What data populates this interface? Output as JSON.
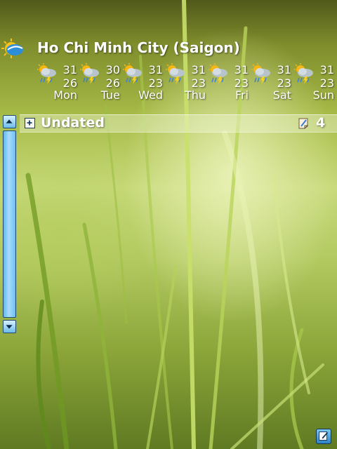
{
  "weather": {
    "city": "Ho Chi Minh City (Saigon)",
    "forecast": [
      {
        "day": "Mon",
        "high": "31",
        "low": "26",
        "icon": "thunderstorm-icon"
      },
      {
        "day": "Tue",
        "high": "30",
        "low": "26",
        "icon": "thunderstorm-icon"
      },
      {
        "day": "Wed",
        "high": "31",
        "low": "23",
        "icon": "thunderstorm-icon"
      },
      {
        "day": "Thu",
        "high": "31",
        "low": "23",
        "icon": "thunderstorm-icon"
      },
      {
        "day": "Fri",
        "high": "31",
        "low": "23",
        "icon": "thunderstorm-icon"
      },
      {
        "day": "Sat",
        "high": "31",
        "low": "23",
        "icon": "thunderstorm-icon"
      },
      {
        "day": "Sun",
        "high": "31",
        "low": "23",
        "icon": "thunderstorm-icon"
      }
    ]
  },
  "tasks": {
    "group_label": "Undated",
    "count": "4"
  },
  "colors": {
    "scrollbar": "#6cbbe8",
    "scrollbar_border": "#1f4a74",
    "text": "#ffffff"
  }
}
